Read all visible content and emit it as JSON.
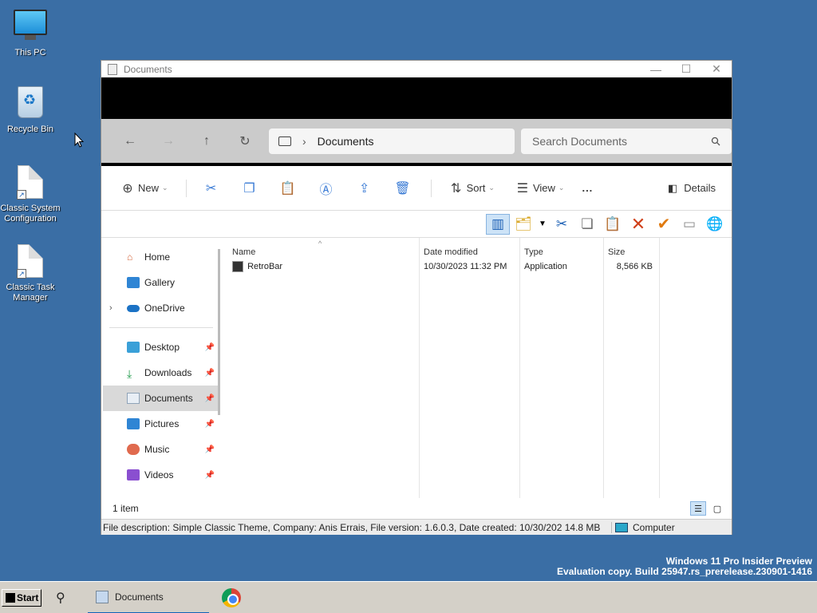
{
  "desktop": {
    "icons": [
      {
        "label": "This PC",
        "icon": "monitor-icon"
      },
      {
        "label": "Recycle Bin",
        "icon": "recycle-bin-icon"
      },
      {
        "label": "Classic System Configuration",
        "icon": "document-shortcut-icon"
      },
      {
        "label": "Classic Task Manager",
        "icon": "document-shortcut-icon"
      }
    ]
  },
  "window": {
    "title": "Documents",
    "address": {
      "location": "Documents"
    },
    "search": {
      "placeholder": "Search Documents"
    },
    "toolbar": {
      "new_label": "New",
      "sort_label": "Sort",
      "view_label": "View",
      "more_label": "...",
      "details_label": "Details"
    },
    "navpane": {
      "items": [
        {
          "label": "Home"
        },
        {
          "label": "Gallery"
        },
        {
          "label": "OneDrive"
        },
        {
          "label": "Desktop"
        },
        {
          "label": "Downloads"
        },
        {
          "label": "Documents"
        },
        {
          "label": "Pictures"
        },
        {
          "label": "Music"
        },
        {
          "label": "Videos"
        }
      ]
    },
    "columns": {
      "name": "Name",
      "date": "Date modified",
      "type": "Type",
      "size": "Size"
    },
    "files": [
      {
        "name": "RetroBar",
        "date": "10/30/2023 11:32 PM",
        "type": "Application",
        "size": "8,566 KB"
      }
    ],
    "status": {
      "item_count": "1 item"
    },
    "classic_status": {
      "description": "File description: Simple Classic Theme, Company: Anis Errais, File version: 1.6.0.3, Date created: 10/30/202",
      "size": "14.8 MB",
      "location": "Computer"
    }
  },
  "watermark": {
    "line1": "Windows 11 Pro Insider Preview",
    "line2": "Evaluation copy. Build 25947.rs_prerelease.230901-1416"
  },
  "taskbar": {
    "start_label": "Start",
    "task_label": "Documents"
  },
  "colors": {
    "desktop": "#3a6ea5",
    "accent": "#0f62b8"
  }
}
